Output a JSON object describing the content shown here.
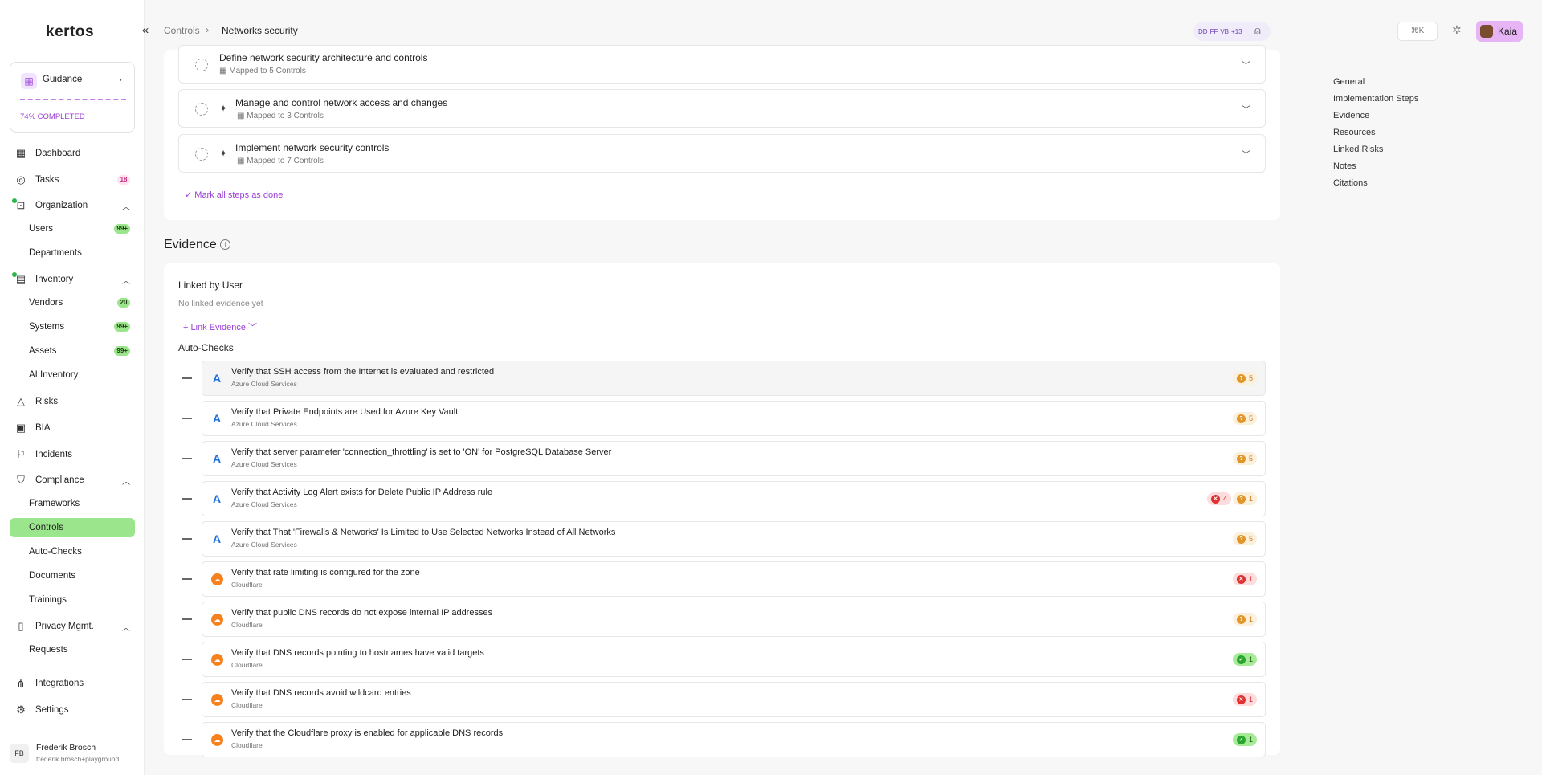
{
  "app": {
    "logo": "kertos"
  },
  "guidance": {
    "label": "Guidance",
    "progress_text": "74% COMPLETED",
    "progress": 0.74
  },
  "nav": {
    "dashboard": "Dashboard",
    "tasks": "Tasks",
    "tasks_count": "18",
    "organization": "Organization",
    "users": "Users",
    "users_count": "99+",
    "departments": "Departments",
    "inventory": "Inventory",
    "vendors": "Vendors",
    "vendors_count": "20",
    "systems": "Systems",
    "systems_count": "99+",
    "assets": "Assets",
    "assets_count": "99+",
    "ai_inventory": "AI Inventory",
    "risks": "Risks",
    "bia": "BIA",
    "incidents": "Incidents",
    "compliance": "Compliance",
    "frameworks": "Frameworks",
    "controls": "Controls",
    "auto_checks": "Auto-Checks",
    "documents": "Documents",
    "trainings": "Trainings",
    "privacy": "Privacy Mgmt.",
    "requests": "Requests",
    "integrations": "Integrations",
    "settings": "Settings"
  },
  "user": {
    "initials": "FB",
    "name": "Frederik Brosch",
    "email": "frederik.brosch+playground..."
  },
  "breadcrumb": {
    "parent": "Controls",
    "current": "Networks security"
  },
  "header": {
    "avatars": [
      "DD",
      "FF",
      "VB",
      "+13"
    ],
    "shortcut": "⌘K",
    "org_name": "Kaia"
  },
  "steps": [
    {
      "title": "Define network security architecture and controls",
      "mapped": "Mapped to 5 Controls"
    },
    {
      "title": "Manage and control network access and changes",
      "mapped": "Mapped to 3 Controls"
    },
    {
      "title": "Implement network security controls",
      "mapped": "Mapped to 7 Controls"
    }
  ],
  "mark_all_done": "Mark all steps as done",
  "evidence": {
    "title": "Evidence",
    "linked_title": "Linked by User",
    "no_linked": "No linked evidence yet",
    "link_button": "Link Evidence",
    "auto_title": "Auto-Checks"
  },
  "checks": [
    {
      "title": "Verify that SSH access from the Internet is evaluated and restricted",
      "source": "Azure Cloud Services",
      "warn": "5"
    },
    {
      "title": "Verify that Private Endpoints are Used for Azure Key Vault",
      "source": "Azure Cloud Services",
      "warn": "5"
    },
    {
      "title": "Verify that server parameter 'connection_throttling' is set to 'ON' for PostgreSQL Database Server",
      "source": "Azure Cloud Services",
      "warn": "5"
    },
    {
      "title": "Verify that Activity Log Alert exists for Delete Public IP Address rule",
      "source": "Azure Cloud Services",
      "err": "4",
      "warn": "1"
    },
    {
      "title": "Verify that That 'Firewalls & Networks' Is Limited to Use Selected Networks Instead of All Networks",
      "source": "Azure Cloud Services",
      "warn": "5"
    },
    {
      "title": "Verify that rate limiting is configured for the zone",
      "source": "Cloudflare",
      "err": "1"
    },
    {
      "title": "Verify that public DNS records do not expose internal IP addresses",
      "source": "Cloudflare",
      "warn": "1"
    },
    {
      "title": "Verify that DNS records pointing to hostnames have valid targets",
      "source": "Cloudflare",
      "ok": "1"
    },
    {
      "title": "Verify that DNS records avoid wildcard entries",
      "source": "Cloudflare",
      "err": "1"
    },
    {
      "title": "Verify that the Cloudflare proxy is enabled for applicable DNS records",
      "source": "Cloudflare",
      "ok": "1"
    }
  ],
  "toc": [
    "General",
    "Implementation Steps",
    "Evidence",
    "Resources",
    "Linked Risks",
    "Notes",
    "Citations"
  ]
}
